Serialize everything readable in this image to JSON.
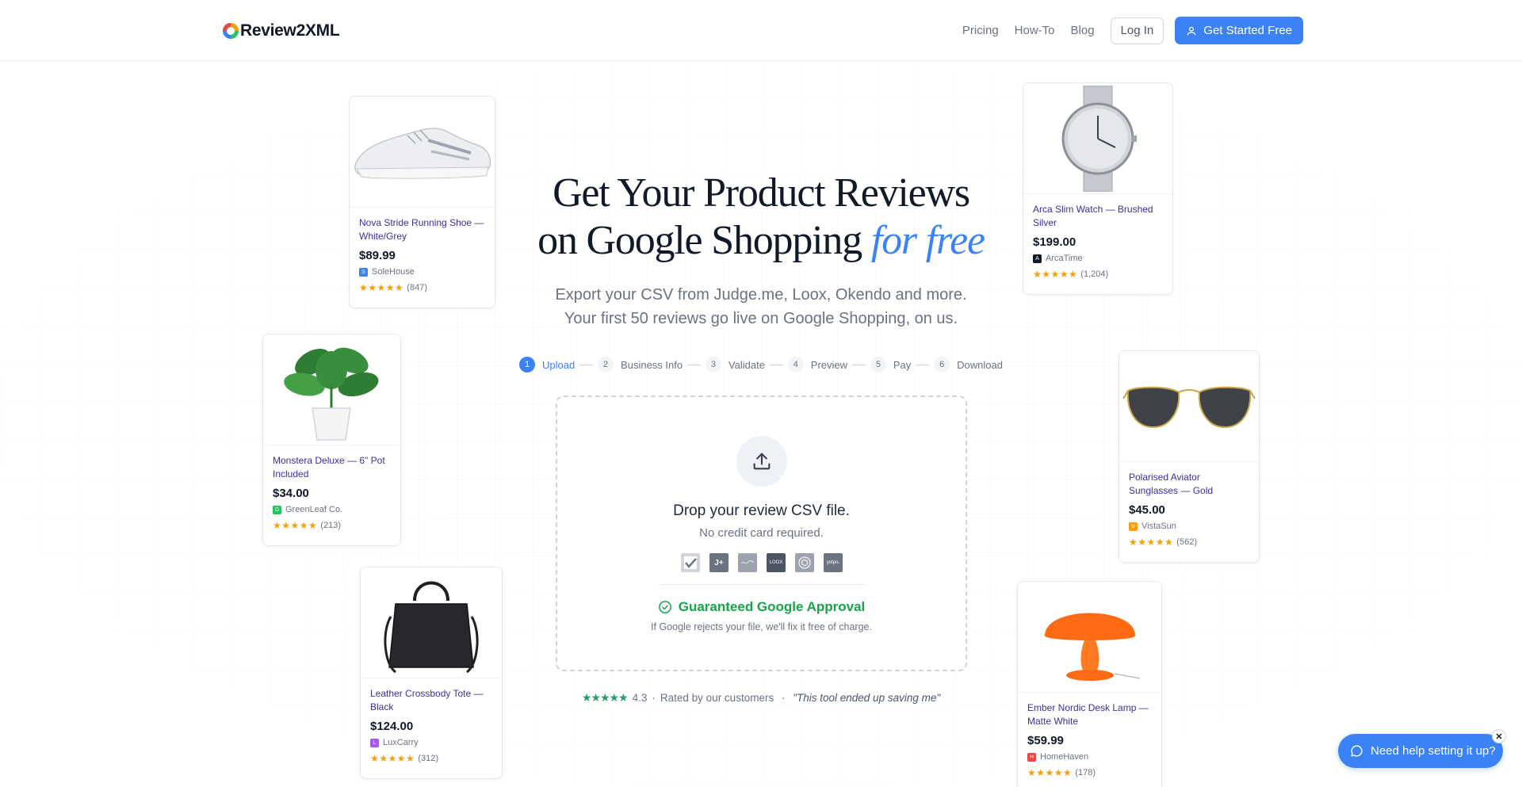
{
  "header": {
    "brand": "Review2XML",
    "nav": [
      "Pricing",
      "How-To",
      "Blog"
    ],
    "login_label": "Log In",
    "cta_label": "Get Started Free"
  },
  "hero": {
    "title_line1": "Get Your Product Reviews",
    "title_line2": "on Google Shopping",
    "title_accent": "for free",
    "subtitle_line1": "Export your CSV from Judge.me, Loox, Okendo and more.",
    "subtitle_line2": "Your first 50 reviews go live on Google Shopping, on us."
  },
  "steps": [
    {
      "num": "1",
      "label": "Upload",
      "active": true
    },
    {
      "num": "2",
      "label": "Business Info",
      "active": false
    },
    {
      "num": "3",
      "label": "Validate",
      "active": false
    },
    {
      "num": "4",
      "label": "Preview",
      "active": false
    },
    {
      "num": "5",
      "label": "Pay",
      "active": false
    },
    {
      "num": "6",
      "label": "Download",
      "active": false
    }
  ],
  "upload": {
    "title": "Drop your review CSV file.",
    "note": "No credit card required.",
    "providers": [
      "judgeme-logo-icon",
      "jdotme-logo-icon",
      "stamped-logo-icon",
      "loox-logo-icon",
      "okendo-logo-icon",
      "yotpo-logo-icon"
    ],
    "provider_labels": [
      "",
      "J+",
      "",
      "LOOX",
      "",
      "yotpo."
    ],
    "guarantee_title": "Guaranteed Google Approval",
    "guarantee_note": "If Google rejects your file, we'll fix it free of charge."
  },
  "rating": {
    "stars": "★★★★★",
    "score": "4.3",
    "label": "Rated by our customers",
    "quote": "\"This tool ended up saving me\""
  },
  "products": [
    {
      "name": "Nova Stride Running Shoe — White/Grey",
      "price": "$89.99",
      "brand": "SoleHouse",
      "brand_initial": "S",
      "brand_color": "#3b82f6",
      "stars": "★★★★★",
      "reviews": "(847)",
      "image": "sneaker"
    },
    {
      "name": "Arca Slim Watch — Brushed Silver",
      "price": "$199.00",
      "brand": "ArcaTime",
      "brand_initial": "A",
      "brand_color": "#111827",
      "stars": "★★★★★",
      "reviews": "(1,204)",
      "image": "watch"
    },
    {
      "name": "Monstera Deluxe — 6\" Pot Included",
      "price": "$34.00",
      "brand": "GreenLeaf Co.",
      "brand_initial": "G",
      "brand_color": "#22c55e",
      "stars": "★★★★★",
      "reviews": "(213)",
      "image": "plant"
    },
    {
      "name": "Polarised Aviator Sunglasses — Gold",
      "price": "$45.00",
      "brand": "VistaSun",
      "brand_initial": "V",
      "brand_color": "#f59e0b",
      "stars": "★★★★★",
      "reviews": "(562)",
      "image": "sunglasses"
    },
    {
      "name": "Leather Crossbody Tote — Black",
      "price": "$124.00",
      "brand": "LuxCarry",
      "brand_initial": "L",
      "brand_color": "#a855f7",
      "stars": "★★★★★",
      "reviews": "(312)",
      "image": "tote"
    },
    {
      "name": "Ember Nordic Desk Lamp — Matte White",
      "price": "$59.99",
      "brand": "HomeHaven",
      "brand_initial": "H",
      "brand_color": "#ef4444",
      "stars": "★★★★★",
      "reviews": "(178)",
      "image": "lamp"
    }
  ],
  "help": {
    "label": "Need help setting it up?",
    "close": "✕"
  },
  "colors": {
    "accent": "#3b82f6",
    "success": "#16a34a",
    "star": "#f59e0b"
  }
}
